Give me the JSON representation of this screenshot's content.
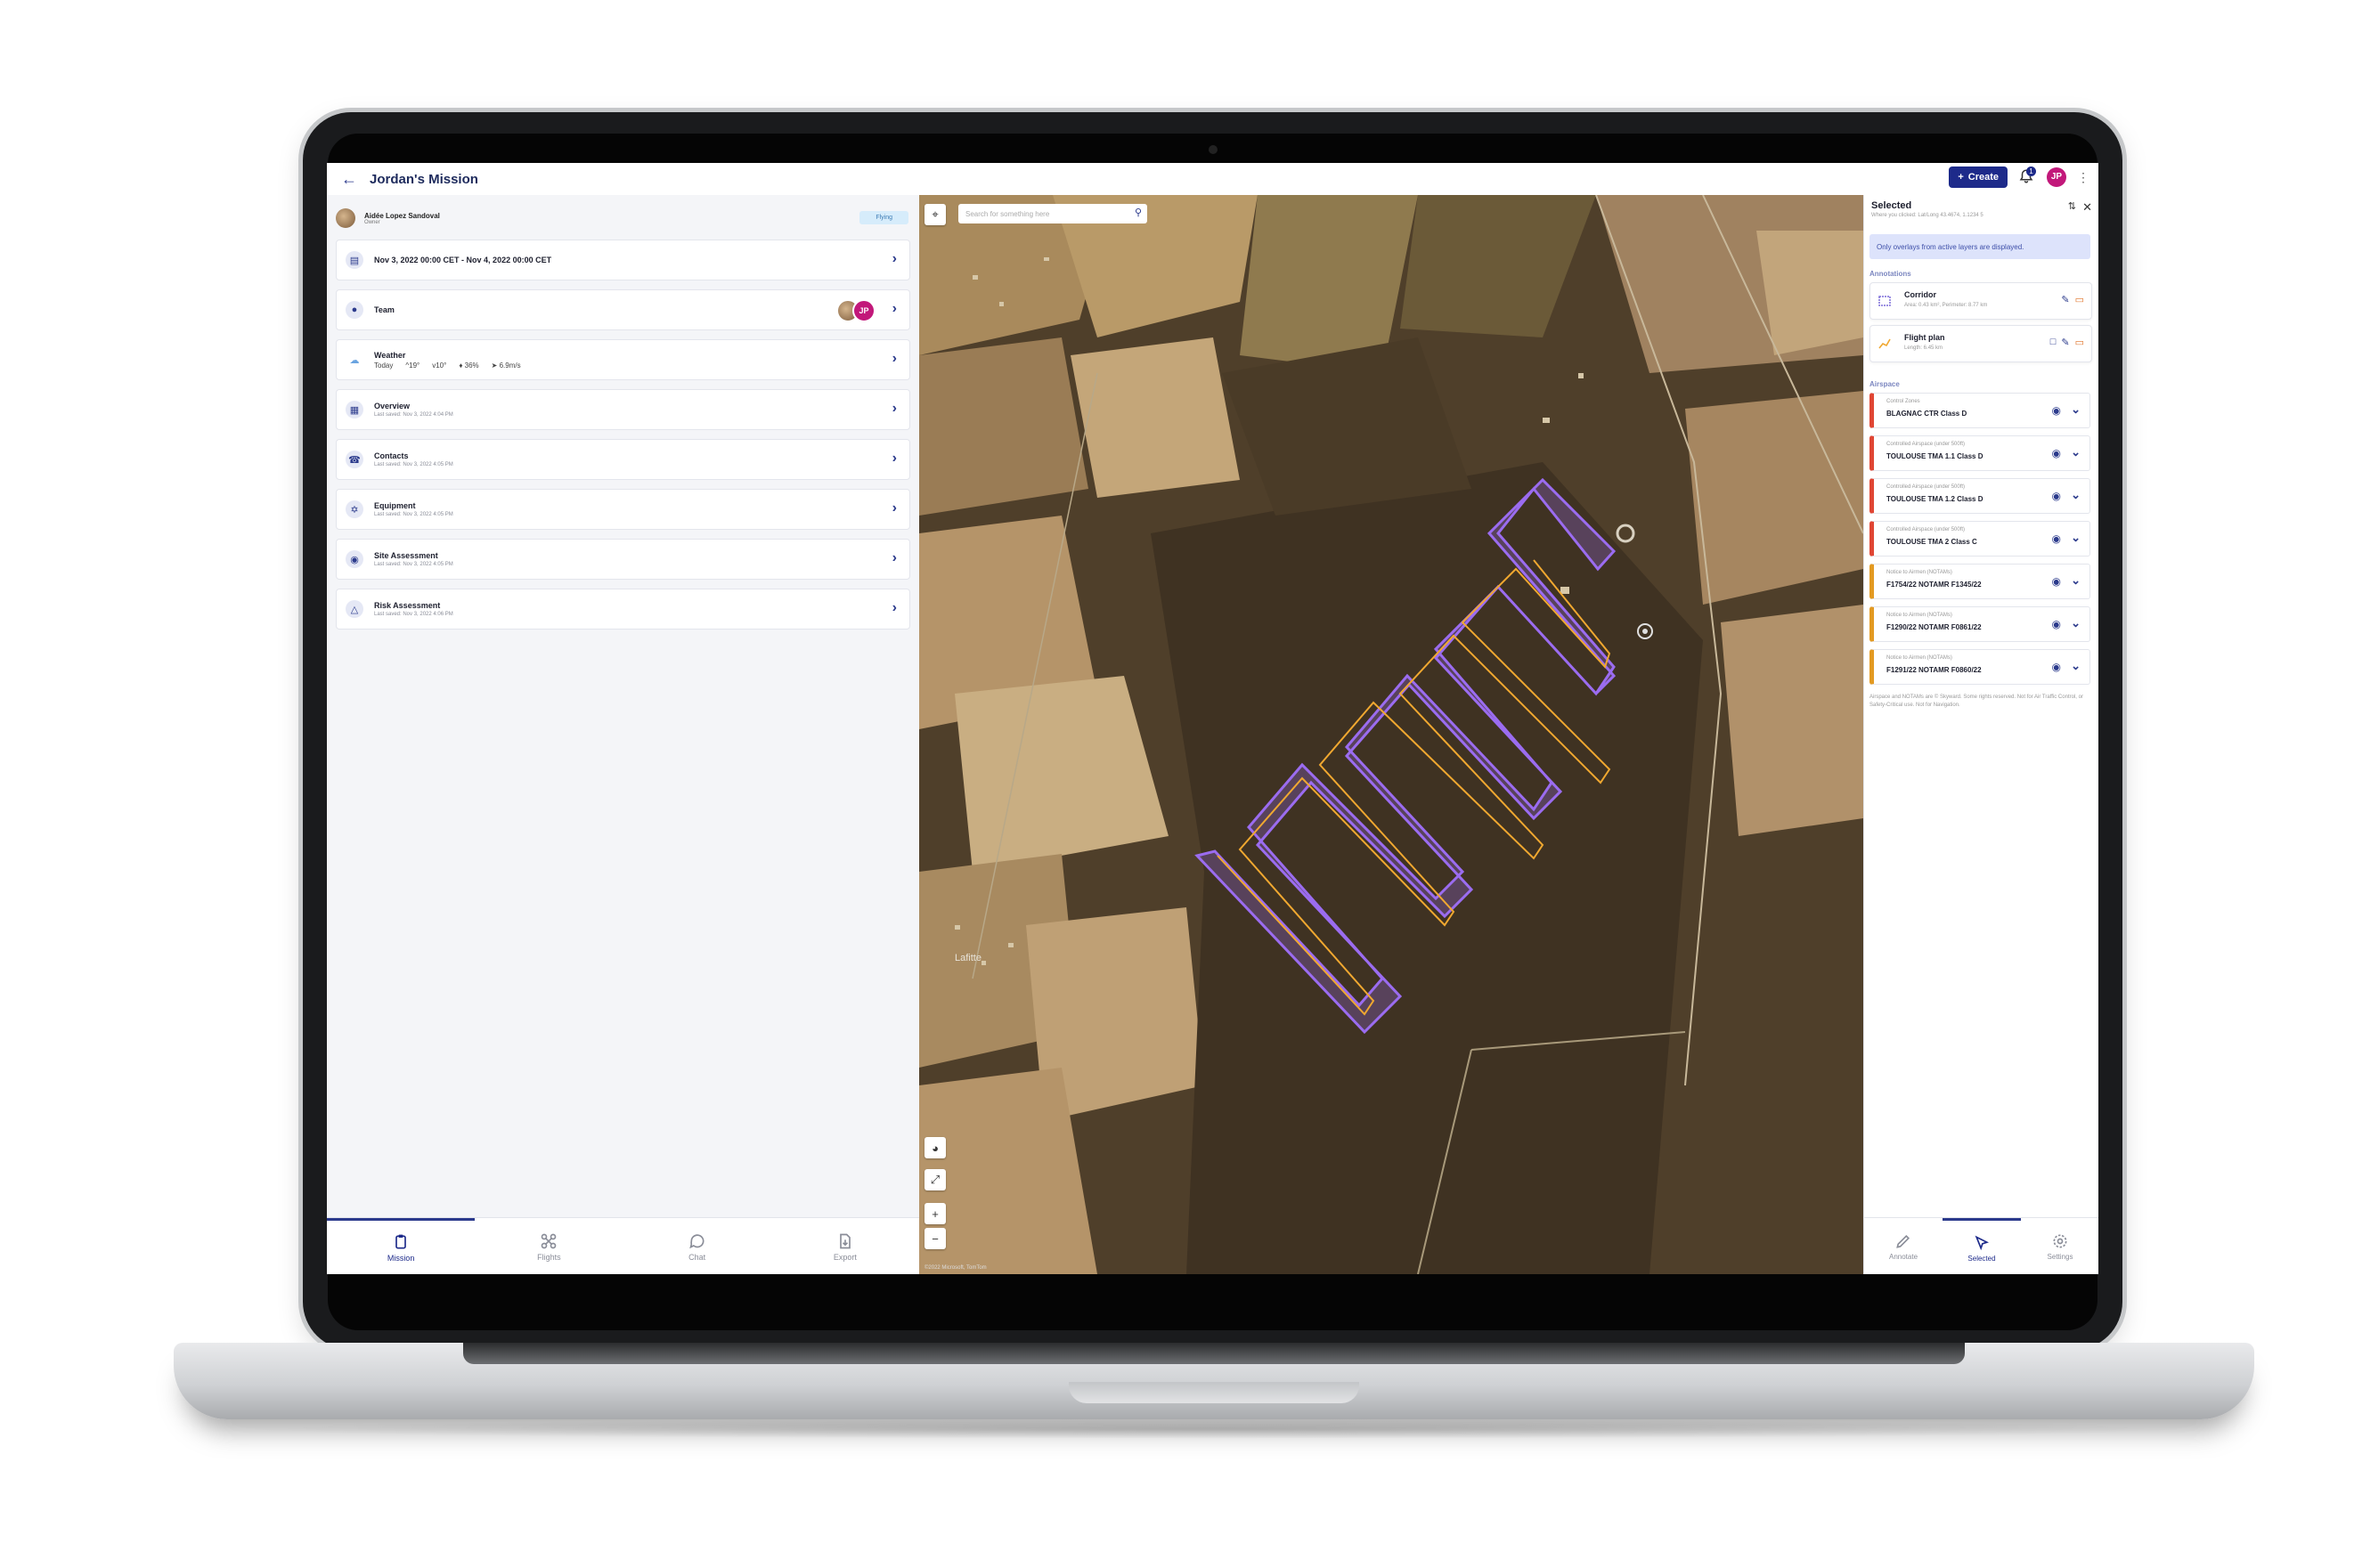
{
  "header": {
    "title": "Jordan's Mission",
    "create_label": "Create",
    "notification_count": "1",
    "user_initials": "JP"
  },
  "owner": {
    "name": "Aidée Lopez Sandoval",
    "role": "Owner",
    "status": "Flying"
  },
  "rows": [
    {
      "title": "Nov 3, 2022 00:00 CET - Nov 4, 2022 00:00 CET",
      "subtitle": "",
      "icon": "calendar-icon"
    },
    {
      "title": "Team",
      "subtitle": "",
      "icon": "people-icon"
    },
    {
      "title": "Weather",
      "subtitle": "Today",
      "icon": "weather-icon"
    },
    {
      "title": "Overview",
      "subtitle": "Last saved: Nov 3, 2022 4:04 PM",
      "icon": "briefcase-icon"
    },
    {
      "title": "Contacts",
      "subtitle": "Last saved: Nov 3, 2022 4:05 PM",
      "icon": "phone-icon"
    },
    {
      "title": "Equipment",
      "subtitle": "Last saved: Nov 3, 2022 4:05 PM",
      "icon": "drone-icon"
    },
    {
      "title": "Site Assessment",
      "subtitle": "Last saved: Nov 3, 2022 4:05 PM",
      "icon": "binoculars-icon"
    },
    {
      "title": "Risk Assessment",
      "subtitle": "Last saved: Nov 3, 2022 4:06 PM",
      "icon": "warning-icon"
    }
  ],
  "weather": {
    "high": "^19°",
    "low": "v10°",
    "humidity": "36%",
    "wind": "6.9m/s"
  },
  "team": {
    "avatar_initials": "JP"
  },
  "left_nav": [
    {
      "label": "Mission",
      "active": true
    },
    {
      "label": "Flights",
      "active": false
    },
    {
      "label": "Chat",
      "active": false
    },
    {
      "label": "Export",
      "active": false
    }
  ],
  "map": {
    "search_placeholder": "Search for something here",
    "place_label": "Lafitte",
    "attribution": "©2022 Microsoft, TomTom"
  },
  "selected_panel": {
    "title": "Selected",
    "subtitle": "Where you clicked: Lat/Long 43.4674, 1.1234 5",
    "info": "Only overlays from active layers are displayed.",
    "annotations_label": "Annotations",
    "annotations": [
      {
        "title": "Corridor",
        "subtitle": "Area: 0.43 km², Perimeter: 8.77 km"
      },
      {
        "title": "Flight plan",
        "subtitle": "Length: 6.45 km"
      }
    ],
    "airspace_label": "Airspace",
    "airspace": [
      {
        "type": "Control Zones",
        "name": "BLAGNAC CTR Class D",
        "kind": "zone"
      },
      {
        "type": "Controlled Airspace (under 500ft)",
        "name": "TOULOUSE TMA 1.1 Class D",
        "kind": "zone"
      },
      {
        "type": "Controlled Airspace (under 500ft)",
        "name": "TOULOUSE TMA 1.2 Class D",
        "kind": "zone"
      },
      {
        "type": "Controlled Airspace (under 500ft)",
        "name": "TOULOUSE TMA 2 Class C",
        "kind": "zone"
      },
      {
        "type": "Notice to Airmen (NOTAMs)",
        "name": "F1754/22 NOTAMR F1345/22",
        "kind": "notam"
      },
      {
        "type": "Notice to Airmen (NOTAMs)",
        "name": "F1290/22 NOTAMR F0861/22",
        "kind": "notam"
      },
      {
        "type": "Notice to Airmen (NOTAMs)",
        "name": "F1291/22 NOTAMR F0860/22",
        "kind": "notam"
      }
    ],
    "disclaimer": "Airspace and NOTAMs are © Skyward. Some rights reserved. Not for Air Traffic Control, or Safety-Critical use. Not for Navigation.",
    "nav": [
      {
        "label": "Annotate",
        "active": false
      },
      {
        "label": "Selected",
        "active": true
      },
      {
        "label": "Settings",
        "active": false
      }
    ]
  },
  "colors": {
    "primary": "#1d2a8a",
    "corridor": "#9b6cf0",
    "flight_path": "#f0a830",
    "zone": "#e04634",
    "notam": "#e39a22"
  }
}
